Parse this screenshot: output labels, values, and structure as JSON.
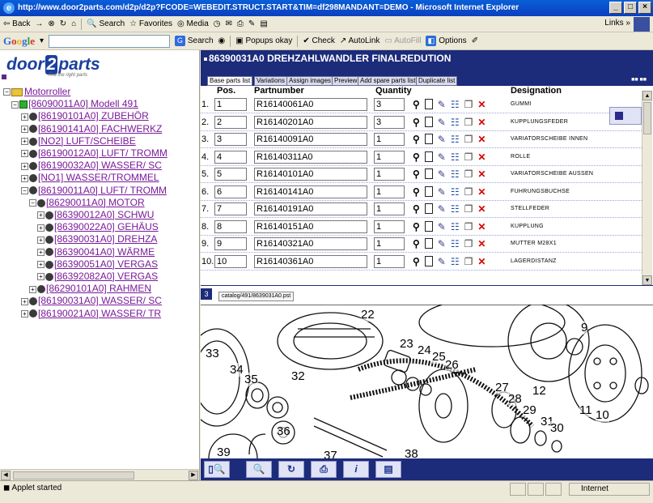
{
  "browser": {
    "title": "http://www.door2parts.com/d2p/d2p?FCODE=WEBEDIT.STRUCT.START&TIM=df298MANDANT=DEMO - Microsoft Internet Explorer",
    "toolbar": {
      "back": "Back",
      "search": "Search",
      "favorites": "Favorites",
      "media": "Media",
      "links": "Links"
    },
    "google_toolbar": {
      "logo": "Google",
      "search": "Search",
      "popups": "Popups okay",
      "check": "Check",
      "autolink": "AutoLink",
      "autofill": "AutoFill",
      "options": "Options"
    },
    "status": {
      "text": "Applet started",
      "zone": "Internet"
    }
  },
  "logo": {
    "part1": "door",
    "part2": "2",
    "part3": "parts",
    "tagline": "find the right parts"
  },
  "tree": [
    {
      "label": "Motorroller",
      "level": 0,
      "icon": "folder-icon"
    },
    {
      "label": "[86090011A0] Modell 491",
      "level": 1,
      "icon": "green-square-icon"
    },
    {
      "label": "[86190101A0] ZUBEHÖR",
      "level": 2,
      "icon": "node-icon"
    },
    {
      "label": "[86190141A0] FACHWERKZ",
      "level": 2,
      "icon": "node-icon"
    },
    {
      "label": "[NO2] LUFT/SCHEIBE",
      "level": 2,
      "icon": "node-icon"
    },
    {
      "label": "[86190012A0] LUFT/ TROMM",
      "level": 2,
      "icon": "node-icon"
    },
    {
      "label": "[86190032A0] WASSER/ SC",
      "level": 2,
      "icon": "node-icon"
    },
    {
      "label": "[NO1] WASSER/TROMMEL",
      "level": 2,
      "icon": "node-icon"
    },
    {
      "label": "[86190011A0] LUFT/ TROMM",
      "level": 2,
      "icon": "node-icon"
    },
    {
      "label": "[86290011A0] MOTOR",
      "level": 3,
      "icon": "node-icon"
    },
    {
      "label": "[86390012A0] SCHWU",
      "level": 4,
      "icon": "node-icon"
    },
    {
      "label": "[86390022A0] GEHÄUS",
      "level": 4,
      "icon": "node-icon"
    },
    {
      "label": "[86390031A0] DREHZA",
      "level": 4,
      "icon": "node-icon"
    },
    {
      "label": "[86390041A0] WÄRME",
      "level": 4,
      "icon": "node-icon"
    },
    {
      "label": "[86390051A0] VERGAS",
      "level": 4,
      "icon": "node-icon"
    },
    {
      "label": "[86392082A0] VERGAS",
      "level": 4,
      "icon": "node-icon"
    },
    {
      "label": "[86290101A0] RAHMEN",
      "level": 3,
      "icon": "node-icon"
    },
    {
      "label": "[86190031A0] WASSER/ SC",
      "level": 2,
      "icon": "node-icon"
    },
    {
      "label": "[86190021A0] WASSER/ TR",
      "level": 2,
      "icon": "node-icon"
    }
  ],
  "header": {
    "title": "86390031A0 DREHZAHLWANDLER FINALREDUTION"
  },
  "tabs": [
    {
      "label": "Base parts list",
      "active": true
    },
    {
      "label": "Variations",
      "active": false
    },
    {
      "label": "Assign images",
      "active": false
    },
    {
      "label": "Preview",
      "active": false
    },
    {
      "label": "Add spare parts list",
      "active": false
    },
    {
      "label": "Duplicate list",
      "active": false
    }
  ],
  "grid": {
    "columns": [
      "Pos.",
      "Partnumber",
      "Quantity",
      "Designation"
    ],
    "rows": [
      {
        "n": "1.",
        "pos": "1",
        "part": "R16140061A0",
        "qty": "3",
        "desig": "GUMMI"
      },
      {
        "n": "2.",
        "pos": "2",
        "part": "R16140201A0",
        "qty": "3",
        "desig": "KUPPLUNGSFEDER"
      },
      {
        "n": "3.",
        "pos": "3",
        "part": "R16140091A0",
        "qty": "1",
        "desig": "VARIATORSCHEIBE INNEN"
      },
      {
        "n": "4.",
        "pos": "4",
        "part": "R16140311A0",
        "qty": "1",
        "desig": "ROLLE"
      },
      {
        "n": "5.",
        "pos": "5",
        "part": "R16140101A0",
        "qty": "1",
        "desig": "VARIATORSCHEIBE AUSSEN"
      },
      {
        "n": "6.",
        "pos": "6",
        "part": "R16140141A0",
        "qty": "1",
        "desig": "FUHRUNGSBUCHSE"
      },
      {
        "n": "7.",
        "pos": "7",
        "part": "R16140191A0",
        "qty": "1",
        "desig": "STELLFEDER"
      },
      {
        "n": "8.",
        "pos": "8",
        "part": "R16140151A0",
        "qty": "1",
        "desig": "KUPPLUNG"
      },
      {
        "n": "9.",
        "pos": "9",
        "part": "R16140321A0",
        "qty": "1",
        "desig": "MUTTER M28X1"
      },
      {
        "n": "10.",
        "pos": "10",
        "part": "R16140361A0",
        "qty": "1",
        "desig": "LAGERDISTANZ"
      }
    ]
  },
  "image_panel": {
    "number": "3",
    "file_tab": "catalog/491/8639031A0.pst",
    "callouts": [
      "22",
      "9",
      "23",
      "24",
      "25",
      "26",
      "33",
      "34",
      "35",
      "32",
      "12",
      "27",
      "28",
      "29",
      "11",
      "10",
      "31",
      "30",
      "36",
      "39",
      "37",
      "38"
    ]
  },
  "icons": {
    "binoculars": "binoculars-icon",
    "doc": "document-icon",
    "edit": "edit-icon",
    "tree": "tree-icon",
    "copy": "copy-icon",
    "delete": "delete-icon"
  },
  "colors": {
    "accent": "#1c2b7a",
    "link": "#7a1a9a",
    "delete": "#d40000"
  }
}
